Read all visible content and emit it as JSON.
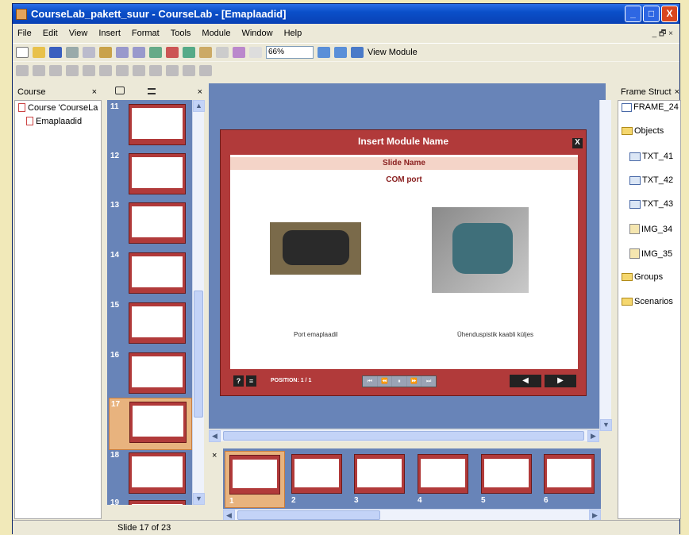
{
  "window": {
    "title": "CourseLab_pakett_suur - CourseLab - [Emaplaadid]",
    "min": "_",
    "max": "□",
    "close": "X"
  },
  "menu": [
    "File",
    "Edit",
    "View",
    "Insert",
    "Format",
    "Tools",
    "Module",
    "Window",
    "Help"
  ],
  "mdi_controls": "_ 🗗 ×",
  "toolbar": {
    "zoom": "66%",
    "view_module": "View Module"
  },
  "course_panel": {
    "title": "Course",
    "close": "×",
    "items": [
      "Course 'CourseLa",
      "Emaplaadid"
    ]
  },
  "slides_panel": {
    "close": "×",
    "numbers": [
      "11",
      "12",
      "13",
      "14",
      "15",
      "16",
      "17",
      "18",
      "19"
    ],
    "selected": "17"
  },
  "slide": {
    "module_name": "Insert Module Name",
    "close": "X",
    "slide_name": "Slide Name",
    "content_title": "COM port",
    "caption_left": "Port emaplaadil",
    "caption_right": "Ühenduspistik kaabli küljes",
    "help": "?",
    "menu": "≡",
    "position": "POSITION: 1 / 1",
    "controls": [
      "⏮",
      "⏪",
      "⏸",
      "⏩",
      "⏭"
    ],
    "prev": "◀",
    "next": "▶"
  },
  "filmstrip": {
    "close": "×",
    "numbers": [
      "1",
      "2",
      "3",
      "4",
      "5",
      "6"
    ]
  },
  "frame_panel": {
    "title": "Frame Struct",
    "close": "×",
    "items": [
      "FRAME_24",
      "Objects",
      "TXT_41",
      "TXT_42",
      "TXT_43",
      "IMG_34",
      "IMG_35",
      "Groups",
      "Scenarios"
    ]
  },
  "status": "Slide 17 of 23"
}
